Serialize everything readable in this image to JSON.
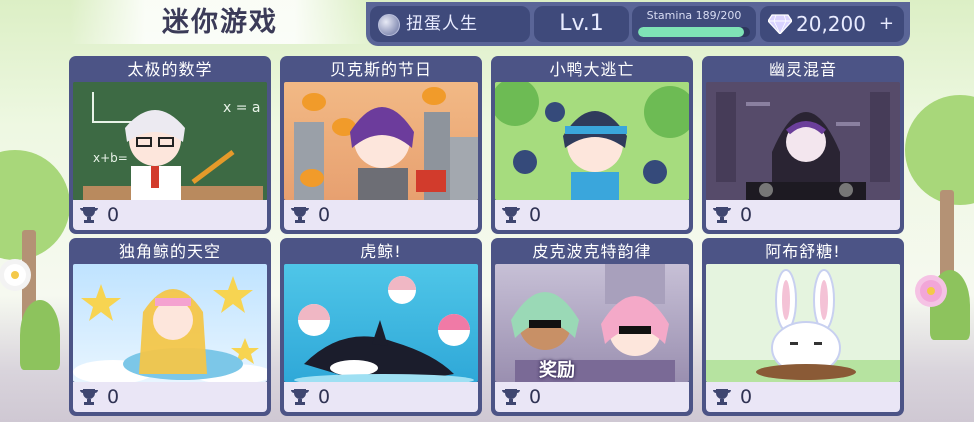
{
  "page": {
    "title": "迷你游戏"
  },
  "topbar": {
    "brand_label": "扭蛋人生",
    "level_label": "Lv.1",
    "stamina_label": "Stamina 189/200",
    "stamina_fraction": 0.945,
    "gems_value": "20,200",
    "gems_plus": "+"
  },
  "games": [
    {
      "title": "太极的数学",
      "score": "0"
    },
    {
      "title": "贝克斯的节日",
      "score": "0"
    },
    {
      "title": "小鸭大逃亡",
      "score": "0"
    },
    {
      "title": "幽灵混音",
      "score": "0"
    },
    {
      "title": "独角鲸的天空",
      "score": "0"
    },
    {
      "title": "虎鲸!",
      "score": "0"
    },
    {
      "title": "皮克波克特韵律",
      "score": "0",
      "overlay": "奖励"
    },
    {
      "title": "阿布舒糖!",
      "score": "0"
    }
  ],
  "colors": {
    "panel": "#4c5486",
    "topbar": "#5a6597",
    "stamina": "#7fe3b6"
  }
}
